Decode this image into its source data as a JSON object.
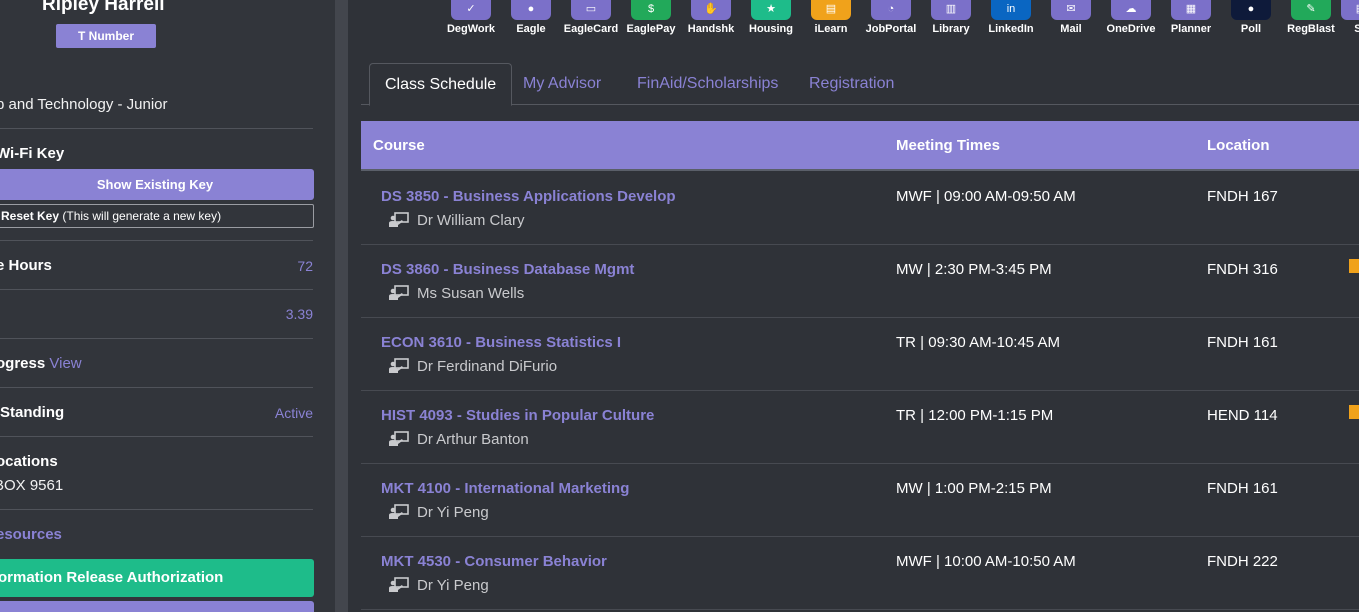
{
  "sidebar": {
    "student_name": "Ripley Harrell",
    "t_number_label": "T Number",
    "program": "p and Technology - Junior",
    "wifi": {
      "title": "Wi-Fi Key",
      "show_label": "Show Existing Key",
      "reset_bold": "Reset Key",
      "reset_note": "(This will generate a new key)"
    },
    "hours": {
      "label": "e Hours",
      "value": "72"
    },
    "gpa": {
      "value": "3.39"
    },
    "progress": {
      "label": "ogress",
      "link": "View"
    },
    "standing": {
      "label": "Standing",
      "value": "Active"
    },
    "locations": {
      "label": "ocations",
      "box": "BOX 9561"
    },
    "resources_label": "esources",
    "info_release_label": "ormation Release Authorization"
  },
  "apps": [
    {
      "label": "DegWork",
      "icon": "degreeworks-icon",
      "color": "#7b70c9",
      "glyph": "✓"
    },
    {
      "label": "Eagle",
      "icon": "eagle-icon",
      "color": "#7b70c9",
      "glyph": "●"
    },
    {
      "label": "EagleCard",
      "icon": "id-card-icon",
      "color": "#7b70c9",
      "glyph": "▭"
    },
    {
      "label": "EaglePay",
      "icon": "dollar-icon",
      "color": "#22a95a",
      "glyph": "$"
    },
    {
      "label": "Handshk",
      "icon": "handshake-icon",
      "color": "#7b70c9",
      "glyph": "✋"
    },
    {
      "label": "Housing",
      "icon": "star-icon",
      "color": "#1ebc8a",
      "glyph": "★"
    },
    {
      "label": "iLearn",
      "icon": "book-icon",
      "color": "#f0a21b",
      "glyph": "▤"
    },
    {
      "label": "JobPortal",
      "icon": "briefcase-icon",
      "color": "#7b70c9",
      "glyph": "◔"
    },
    {
      "label": "Library",
      "icon": "library-icon",
      "color": "#7b70c9",
      "glyph": "▥"
    },
    {
      "label": "LinkedIn",
      "icon": "linkedin-icon",
      "color": "#0a66c2",
      "glyph": "in"
    },
    {
      "label": "Mail",
      "icon": "mail-icon",
      "color": "#7b70c9",
      "glyph": "✉"
    },
    {
      "label": "OneDrive",
      "icon": "cloud-icon",
      "color": "#7b70c9",
      "glyph": "☁"
    },
    {
      "label": "Planner",
      "icon": "planner-icon",
      "color": "#7b70c9",
      "glyph": "▦"
    },
    {
      "label": "Poll",
      "icon": "poll-icon",
      "color": "#0e1a3a",
      "glyph": "●"
    },
    {
      "label": "RegBlast",
      "icon": "pencil-icon",
      "color": "#22a95a",
      "glyph": "✎"
    },
    {
      "label": "Sc",
      "icon": "schedule-icon",
      "color": "#7b70c9",
      "glyph": "▤"
    }
  ],
  "tabs": [
    {
      "label": "Class Schedule",
      "active": true
    },
    {
      "label": "My Advisor",
      "active": false
    },
    {
      "label": "FinAid/Scholarships",
      "active": false
    },
    {
      "label": "Registration",
      "active": false
    }
  ],
  "table": {
    "headers": {
      "course": "Course",
      "meeting": "Meeting Times",
      "location": "Location"
    },
    "rows": [
      {
        "course": "DS 3850 - Business Applications Develop",
        "instructor": "Dr William Clary",
        "meeting": "MWF | 09:00 AM-09:50 AM",
        "location": "FNDH 167",
        "flag": false
      },
      {
        "course": "DS 3860 - Business Database Mgmt",
        "instructor": "Ms Susan Wells",
        "meeting": "MW | 2:30 PM-3:45 PM",
        "location": "FNDH 316",
        "flag": true
      },
      {
        "course": "ECON 3610 - Business Statistics I",
        "instructor": "Dr Ferdinand DiFurio",
        "meeting": "TR | 09:30 AM-10:45 AM",
        "location": "FNDH 161",
        "flag": false
      },
      {
        "course": "HIST 4093 - Studies in Popular Culture",
        "instructor": "Dr Arthur Banton",
        "meeting": "TR | 12:00 PM-1:15 PM",
        "location": "HEND 114",
        "flag": true
      },
      {
        "course": "MKT 4100 - International Marketing",
        "instructor": "Dr Yi Peng",
        "meeting": "MW | 1:00 PM-2:15 PM",
        "location": "FNDH 161",
        "flag": false
      },
      {
        "course": "MKT 4530 - Consumer Behavior",
        "instructor": "Dr Yi Peng",
        "meeting": "MWF | 10:00 AM-10:50 AM",
        "location": "FNDH 222",
        "flag": false
      }
    ]
  },
  "colors": {
    "accent": "#8a82d4",
    "success": "#1ebc8a",
    "background": "#2f3238",
    "warning": "#f0a21b"
  }
}
